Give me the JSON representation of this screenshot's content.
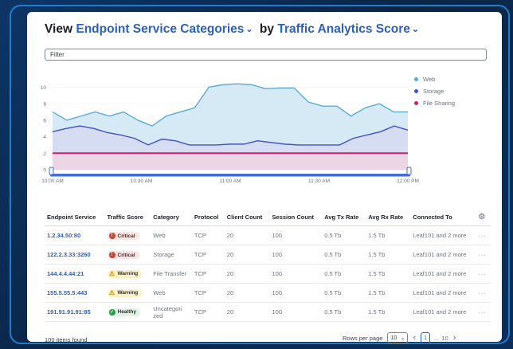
{
  "title": {
    "prefix": "View",
    "dimension": "Endpoint Service Categories",
    "by": "by",
    "metric": "Traffic Analytics Score"
  },
  "filter": {
    "placeholder": "Filter"
  },
  "chart_data": {
    "type": "area",
    "x": [
      "10:00 AM",
      "",
      "",
      "",
      "",
      "",
      "10:30 AM",
      "",
      "",
      "",
      "",
      "11:00 AM",
      "",
      "",
      "",
      "",
      "11:30 AM",
      "",
      "",
      "",
      "",
      "",
      "12:00 PM"
    ],
    "xticks": [
      "10:00 AM",
      "10:30 AM",
      "11:00 AM",
      "11:30 AM",
      "12:00 PM"
    ],
    "yticks": [
      0,
      2,
      4,
      6,
      8,
      10
    ],
    "ylim": [
      0,
      11
    ],
    "series": [
      {
        "name": "Web",
        "color": "#5aabd6",
        "fill": "#cfe6f5",
        "values": [
          7,
          6,
          6.5,
          7,
          6.5,
          7,
          6,
          5.3,
          6.5,
          7,
          7.5,
          10,
          10.3,
          10.4,
          10.3,
          9.8,
          9.9,
          9.9,
          8.2,
          7.7,
          7.7,
          6.5,
          7.5,
          8,
          7,
          7
        ]
      },
      {
        "name": "Storage",
        "color": "#3f51c7",
        "fill": "#d6daf2",
        "values": [
          4.6,
          5,
          5.3,
          5,
          4.5,
          4.2,
          3.8,
          3,
          3.7,
          3.5,
          3,
          3,
          3,
          3.1,
          3.1,
          3.5,
          3.3,
          3.1,
          3,
          3,
          3,
          3,
          3.8,
          4.2,
          4.6,
          5.3,
          4.8
        ]
      },
      {
        "name": "File Sharing",
        "color": "#c0266b",
        "fill": "#f0d3e1",
        "values": [
          2,
          2,
          2,
          2,
          2,
          2,
          2,
          2,
          2,
          2,
          2,
          2,
          2,
          2,
          2,
          2,
          2,
          2,
          2,
          2,
          2,
          2,
          2,
          2,
          2,
          2,
          2
        ]
      }
    ]
  },
  "table": {
    "headers": [
      "Endpoint Service",
      "Traffic Score",
      "Category",
      "Protocol",
      "Client Count",
      "Session Count",
      "Avg Tx Rate",
      "Avg Rx Rate",
      "Connected To"
    ],
    "rows": [
      {
        "service": "1.2.34.50:80",
        "score": "Critical",
        "status": "critical",
        "category": "Web",
        "protocol": "TCP",
        "clients": "20",
        "sessions": "100",
        "tx": "0.5 Tb",
        "rx": "1.5 Tb",
        "connected": "Leaf101 and 2 more"
      },
      {
        "service": "122.2.3.33:3260",
        "score": "Critical",
        "status": "critical",
        "category": "Storage",
        "protocol": "TCP",
        "clients": "20",
        "sessions": "100",
        "tx": "0.5 Tb",
        "rx": "1.5 Tb",
        "connected": "Leaf101 and 2 more"
      },
      {
        "service": "144.4.4.44:21",
        "score": "Warning",
        "status": "warning",
        "category": "File Transfer",
        "protocol": "TCP",
        "clients": "20",
        "sessions": "100",
        "tx": "0.5 Tb",
        "rx": "1.5 Tb",
        "connected": "Leaf101 and 2 more"
      },
      {
        "service": "155.5.55.5:443",
        "score": "Warning",
        "status": "warning",
        "category": "Web",
        "protocol": "TCP",
        "clients": "20",
        "sessions": "100",
        "tx": "0.5 Tb",
        "rx": "1.5 Tb",
        "connected": "Leaf101 and 2 more"
      },
      {
        "service": "191.91.91.91:85",
        "score": "Healthy",
        "status": "healthy",
        "category": "Uncategori zed",
        "protocol": "TCP",
        "clients": "20",
        "sessions": "100",
        "tx": "0.5 Tb",
        "rx": "1.5 Tb",
        "connected": "Leaf101 and 2 more"
      }
    ],
    "row_menu": "···"
  },
  "footer": {
    "items_found": "100 items found",
    "rows_per_page_label": "Rows per page",
    "rows_per_page_value": "10",
    "current_page": "1",
    "ellipsis": "...",
    "last_page": "10"
  },
  "icons": {
    "title_chevron": "chevron-down-icon",
    "settings": "gear-icon",
    "prev": "chevron-left-icon",
    "next": "chevron-right-icon"
  }
}
